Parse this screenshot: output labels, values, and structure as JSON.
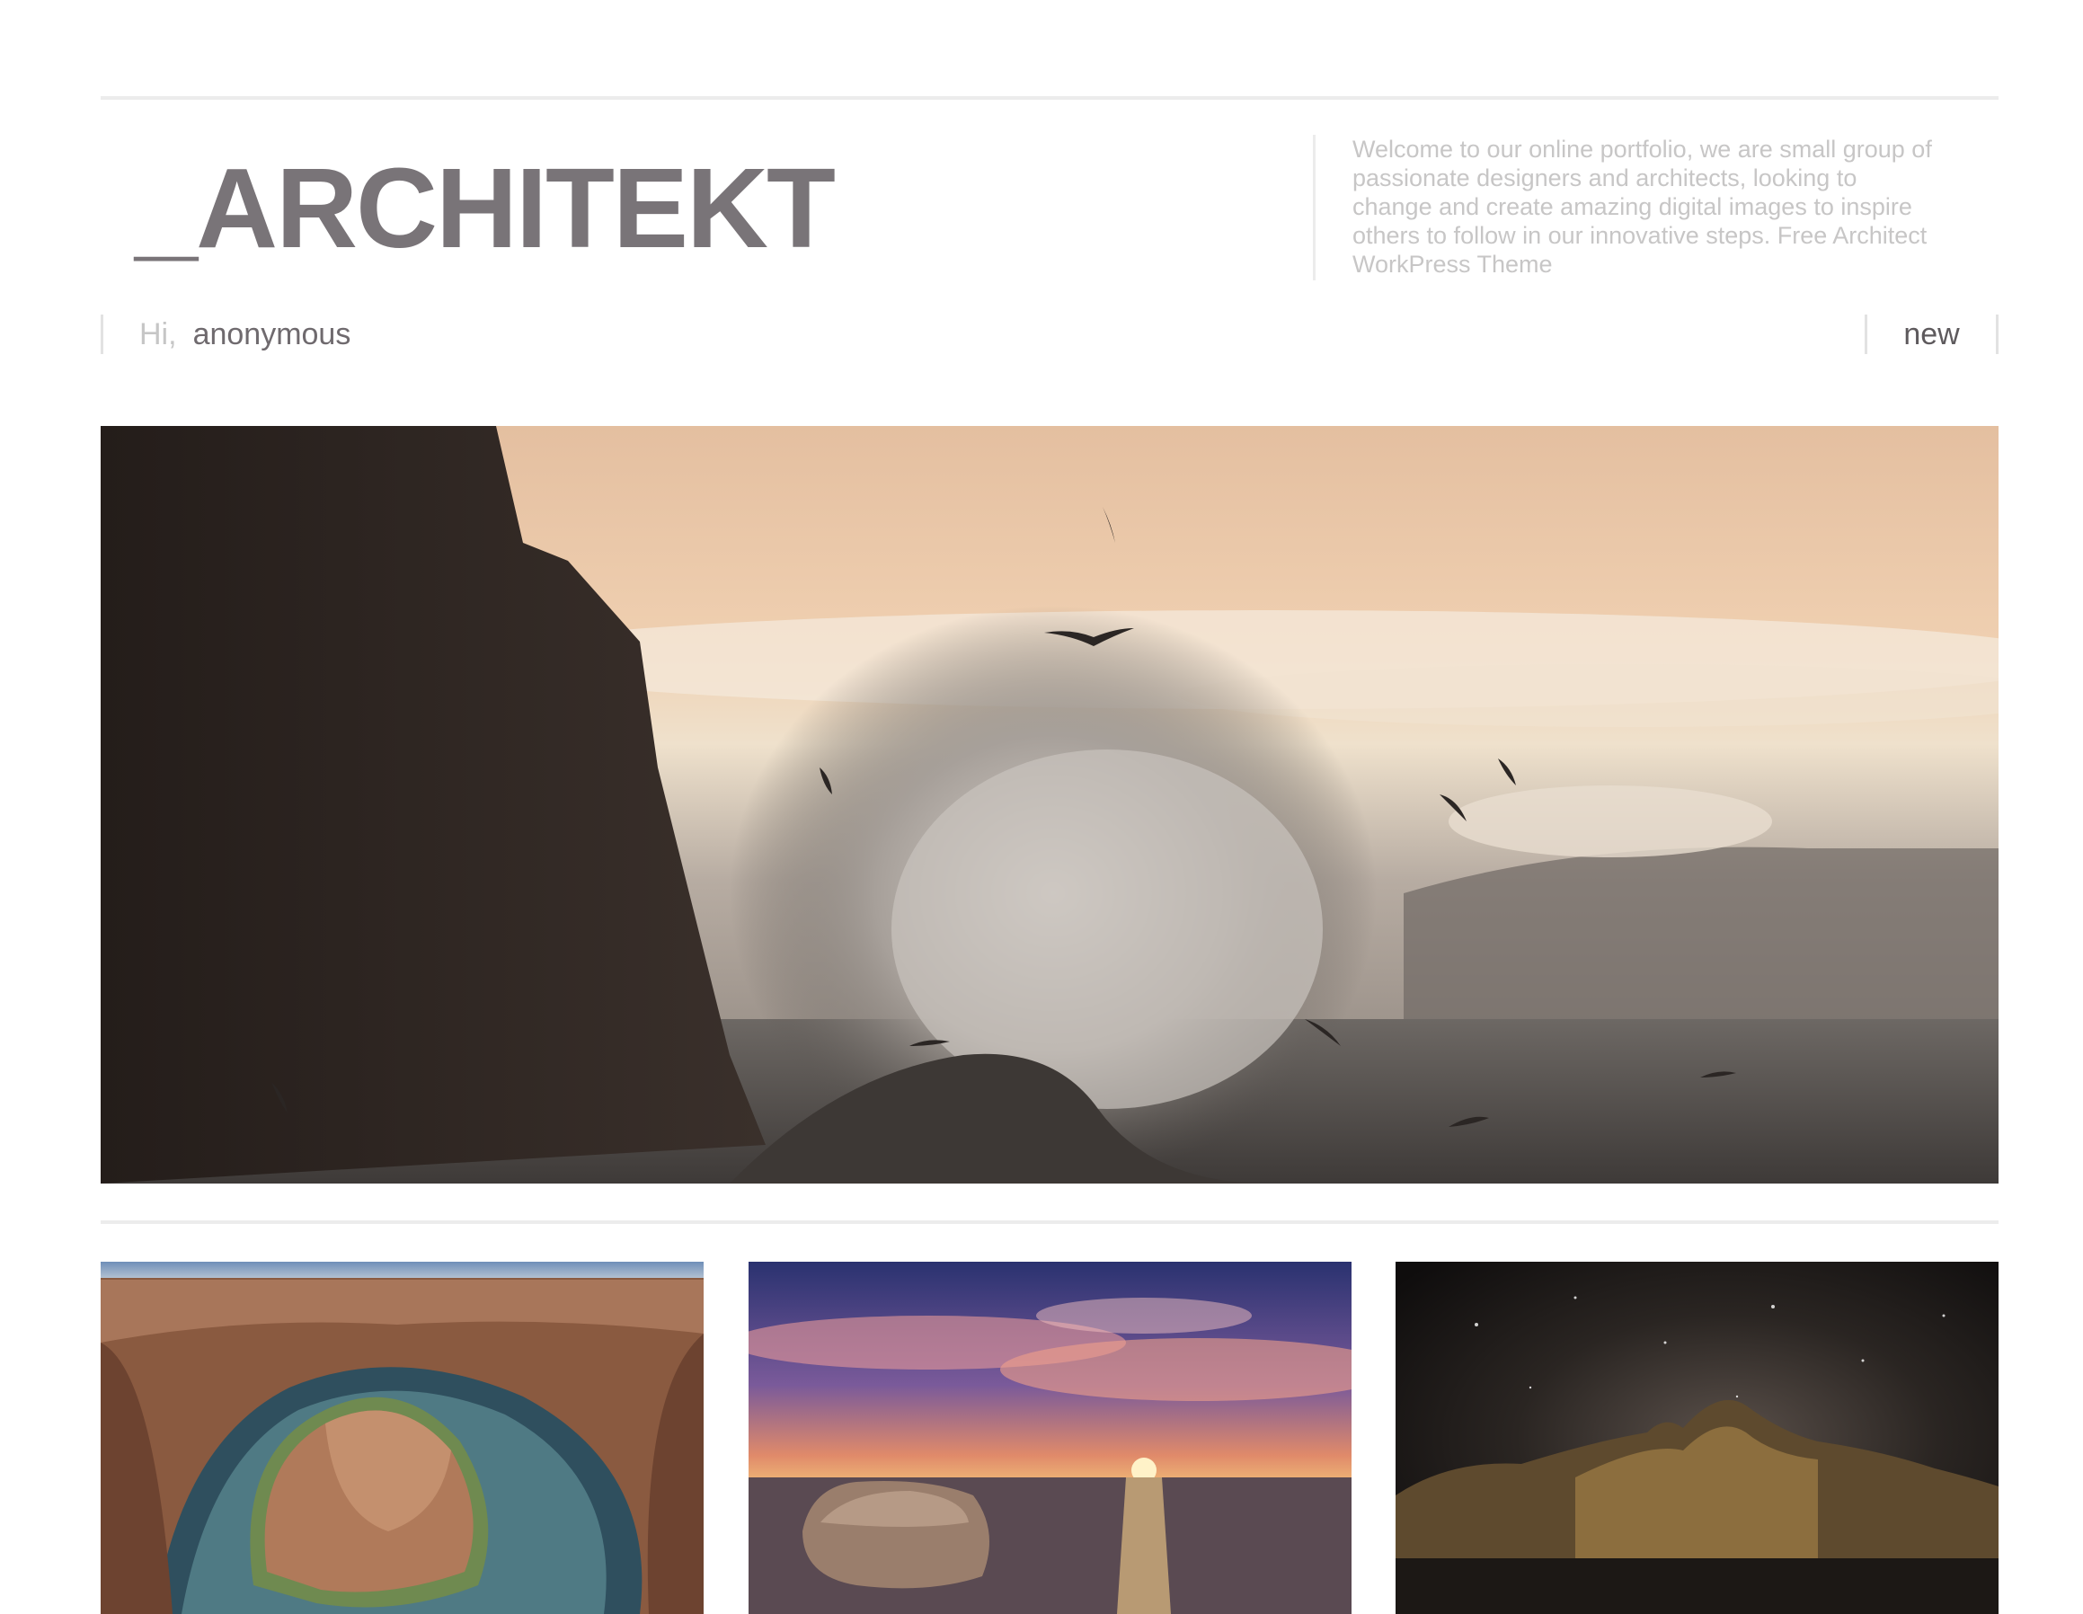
{
  "header": {
    "logo_text": "_ARCHITEKT",
    "intro_text": "Welcome to our online portfolio, we are small group of passionate designers and architects, looking to change and create amazing digital images to inspire others to follow in our innovative steps. Free Architect WorkPress Theme"
  },
  "user_bar": {
    "greeting": "Hi,",
    "username": "anonymous",
    "new_label": "new"
  },
  "gallery": {
    "hero": {
      "icon": "photo-wave-seabirds"
    },
    "thumbnails": [
      {
        "icon": "photo-canyon-river-bend"
      },
      {
        "icon": "photo-sunset-beach-rock"
      },
      {
        "icon": "photo-night-sky-mountain"
      }
    ]
  },
  "colors": {
    "logo": "#797478",
    "intro_text": "#c7c6c6",
    "divider": "#ececec"
  }
}
